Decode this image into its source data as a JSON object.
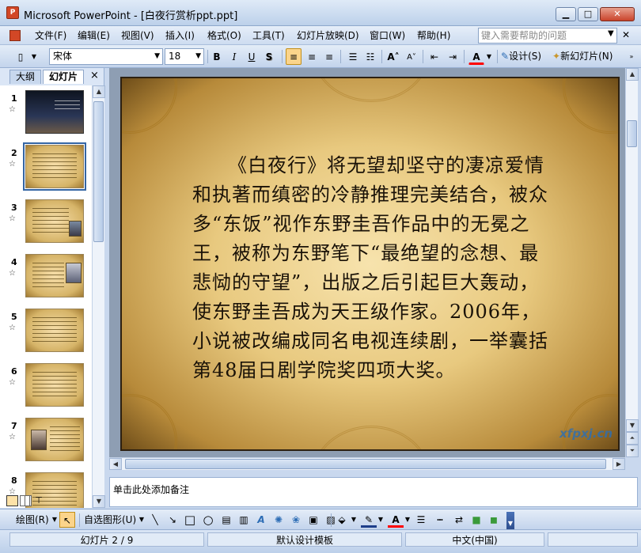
{
  "window": {
    "app_icon": "P",
    "title": "Microsoft PowerPoint - [白夜行赏析ppt.ppt]",
    "minimize": "▁",
    "maximize": "□",
    "close": "✕"
  },
  "menu": {
    "items": [
      "文件(F)",
      "编辑(E)",
      "视图(V)",
      "插入(I)",
      "格式(O)",
      "工具(T)",
      "幻灯片放映(D)",
      "窗口(W)",
      "帮助(H)"
    ],
    "help_placeholder": "键入需要帮助的问题"
  },
  "toolbar": {
    "font_name": "宋体",
    "font_size": "18",
    "bold": "B",
    "italic": "I",
    "underline": "U",
    "shadow": "S",
    "design_label": "设计(S)",
    "new_slide_label": "新幻灯片(N)",
    "font_color": "#ff0000"
  },
  "left_pane": {
    "tabs": [
      "大纲",
      "幻灯片"
    ],
    "close": "×",
    "slide_numbers": [
      "1",
      "2",
      "3",
      "4",
      "5",
      "6",
      "7",
      "8"
    ],
    "selected_slide": 2
  },
  "slide": {
    "body": "《白夜行》将无望却坚守的凄凉爱情和执著而缜密的冷静推理完美结合，被众多“东饭”视作东野圭吾作品中的无冕之王，被称为东野笔下“最绝望的念想、最悲恸的守望”，出版之后引起巨大轰动，使东野圭吾成为天王级作家。2006年，小说被改编成同名电视连续剧，一举囊括第48届日剧学院奖四项大奖。",
    "watermark": "xfpxj.cn"
  },
  "notes": {
    "placeholder": "单击此处添加备注"
  },
  "drawing_toolbar": {
    "draw_label": "绘图(R)",
    "autoshapes_label": "自选图形(U)"
  },
  "status": {
    "slide_position": "幻灯片 2 / 9",
    "template": "默认设计模板",
    "language": "中文(中国)"
  },
  "colors": {
    "accent": "#3465a4",
    "slide_gold": "#e8c97f"
  }
}
